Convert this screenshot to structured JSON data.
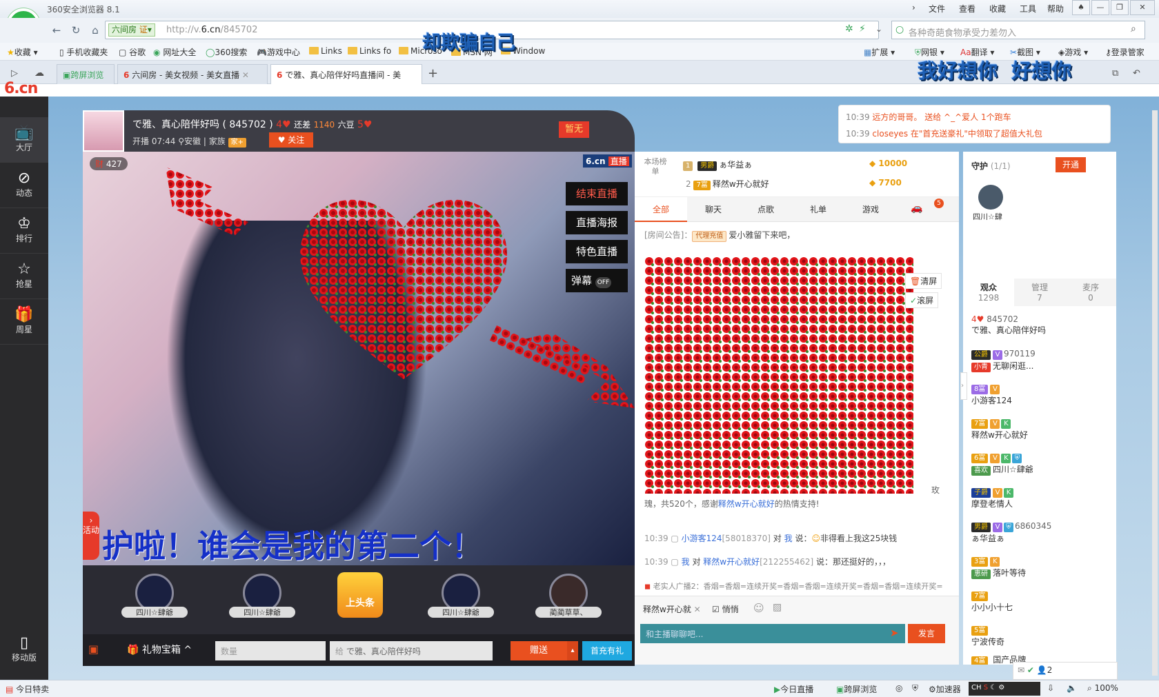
{
  "browser": {
    "title": "360安全浏览器 8.1",
    "menu": [
      "文件",
      "查看",
      "收藏",
      "工具",
      "帮助"
    ],
    "address": {
      "site_label": "六间房",
      "badge": "证",
      "url_prefix": "http://v.",
      "url_host": "6.cn",
      "url_path": "/845702"
    },
    "search_placeholder": "各种奇葩食物承受力差勿入",
    "favorites": [
      "收藏",
      "手机收藏夹",
      "谷歌",
      "网址大全",
      "360搜索",
      "游戏中心",
      "Links",
      "Links fo",
      "Microso",
      "MSN 网",
      "Window"
    ],
    "fav_right": [
      "扩展",
      "网银",
      "翻译",
      "截图",
      "游戏",
      "登录管家"
    ],
    "tabs": [
      {
        "label": "跨屏浏览"
      },
      {
        "label": "六间房 - 美女视频 - 美女直播"
      },
      {
        "label": "で雅、真心陪伴好吗直播间 - 美"
      }
    ],
    "overlay_text_1": "却欺骗自己",
    "overlay_text_2": "我好想你  好想你"
  },
  "site": {
    "logo": "6.cn",
    "leftnav": [
      {
        "label": "大厅",
        "icon": "tv-icon"
      },
      {
        "label": "动态",
        "icon": "compass-icon"
      },
      {
        "label": "排行",
        "icon": "crown-icon"
      },
      {
        "label": "抢星",
        "icon": "star-icon"
      },
      {
        "label": "周星",
        "icon": "gift-icon"
      }
    ],
    "mobile_label": "移动版",
    "anchor": {
      "name": "で雅、真心陪伴好吗 ( 845702 )",
      "remaining": "还差",
      "beans": "1140",
      "beans_unit": "六豆",
      "start": "开播 07:44",
      "location": "安徽",
      "family": "家族",
      "follow": "关注",
      "flag": "暂无",
      "wealth": "427"
    },
    "video_buttons": [
      "结束直播",
      "直播海报",
      "特色直播",
      "弹幕"
    ],
    "danmu_state": "OFF",
    "video_logo": "6.cn",
    "video_logo_tag": "直播",
    "activity_label": "活动",
    "scroll_text": "护啦！谁会是我的第二个！",
    "gift_row": [
      {
        "name": "四川☆肆爺"
      },
      {
        "name": "四川☆肆爺"
      },
      {
        "name": "上头条"
      },
      {
        "name": "四川☆肆爺"
      },
      {
        "name": "蔺蔺草草、"
      }
    ],
    "giftbar": {
      "box_label": "礼物宝箱",
      "qty_placeholder": "数量",
      "to_label": "给",
      "to_name": "で雅、真心陪伴好吗",
      "send": "赠送",
      "first_recharge": "首充有礼"
    },
    "notice": [
      {
        "time": "10:39",
        "text": "远方的哥哥。 送给 ^_^爱人 1个跑车"
      },
      {
        "time": "10:39",
        "text": "closeyes 在\"首充送豪礼\"中领取了超值大礼包"
      }
    ],
    "rank": {
      "label": "本场榜单",
      "rows": [
        {
          "rank": "1",
          "badge": "男爵",
          "name": "ぁ华益ぁ",
          "value": "10000"
        },
        {
          "rank": "2",
          "badge": "7富",
          "name": "释然w开心就好",
          "value": "7700"
        }
      ]
    },
    "chat_tabs": [
      "全部",
      "聊天",
      "点歌",
      "礼单",
      "游戏"
    ],
    "car_count": "5",
    "announcement": {
      "label": "[房间公告]：",
      "tag": "代理充值",
      "text": "爱小雅留下来吧，"
    },
    "chat_tools": [
      "清屏",
      "滚屏"
    ],
    "gift_thanks": {
      "prefix": "瑰，共520个，感谢",
      "name": "释然w开心就好",
      "suffix": "的热情支持!",
      "side": "玫"
    },
    "chat": [
      {
        "time": "10:39",
        "user": "小游客124",
        "id": "[58018370]",
        "action": "对",
        "target": "我",
        "says": "说：",
        "text": "非得看上我这25块钱"
      },
      {
        "time": "10:39",
        "user": "我",
        "action": "对",
        "target": "释然w开心就好",
        "id": "[212255462]",
        "says": "说：",
        "text": "那还挺好的，，，"
      }
    ],
    "broadcast": "老实人广播2：香烟=香烟=连续开奖=香烟=香烟=连续开奖=香烟=香烟=连续开奖=",
    "chat_input": {
      "target": "释然w开心就",
      "quiet": "悄悄",
      "placeholder": "和主播聊聊吧...",
      "send": "发言"
    },
    "guard": {
      "title": "守护",
      "count": "(1/1)",
      "open": "开通",
      "member": "四川☆肆"
    },
    "audience_tabs": [
      {
        "label": "观众",
        "count": "1298"
      },
      {
        "label": "管理",
        "count": "7"
      },
      {
        "label": "麦序",
        "count": "0"
      }
    ],
    "audience": [
      {
        "line1": "845702",
        "line2": "で雅、真心陪伴好吗"
      },
      {
        "line1": "970119",
        "badge": "小青",
        "line2": "无聊闲逛..."
      },
      {
        "line2": "小游客124"
      },
      {
        "line2": "释然w开心就好"
      },
      {
        "badge": "喜欢",
        "line2": "四川☆肆爺"
      },
      {
        "line2": "摩登老情人"
      },
      {
        "line1": "6860345",
        "line2": "ぁ华益ぁ"
      },
      {
        "badge": "恵研",
        "line2": "落叶等待"
      },
      {
        "line2": "小小小十七"
      },
      {
        "line2": "宁波传奇"
      },
      {
        "line2": "国产品牌"
      }
    ],
    "float_count": "2"
  },
  "statusbar": {
    "left": "今日特卖",
    "items": [
      "今日直播",
      "跨屏浏览",
      "加速器"
    ],
    "zoom": "100%"
  }
}
